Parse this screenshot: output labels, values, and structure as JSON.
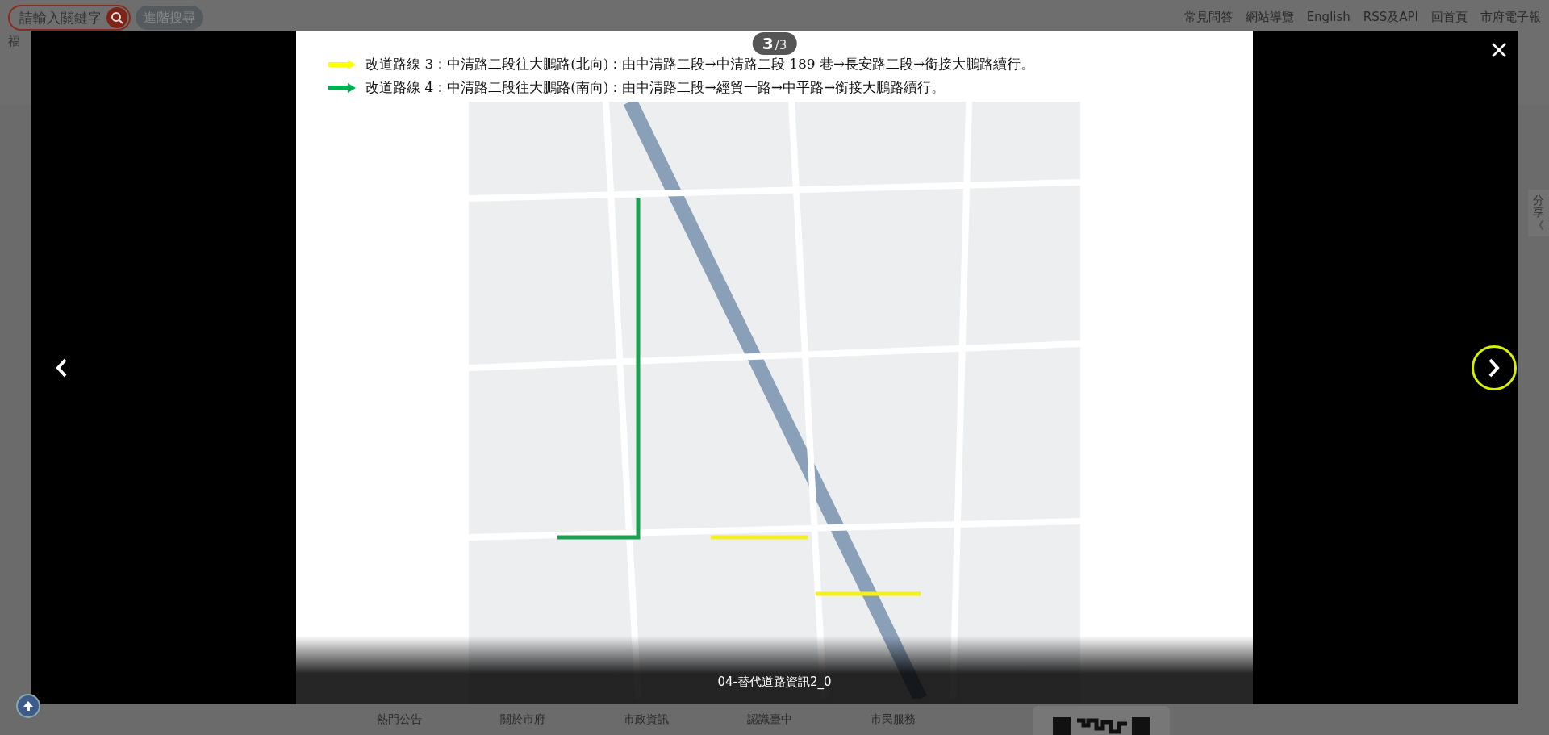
{
  "header": {
    "search": {
      "placeholder": "請輸入關鍵字"
    },
    "advanced_search": "進階搜尋",
    "left_text": "福",
    "links": [
      "常見問答",
      "網站導覽",
      "English",
      "RSS及API",
      "回首頁",
      "市府電子報"
    ]
  },
  "share_tab": {
    "label": "分享",
    "chevron": "《"
  },
  "lightbox": {
    "counter": {
      "current": "3",
      "total": "/3"
    },
    "legend": [
      {
        "label": "改道路線 3：中清路二段往大鵬路(北向)：由中清路二段→中清路二段 189 巷→長安路二段→銜接大鵬路續行。",
        "color": "#ffff00"
      },
      {
        "label": "改道路線 4：中清路二段往大鵬路(南向)：由中清路二段→經貿一路→中平路→銜接大鵬路續行。",
        "color": "#00b050"
      }
    ],
    "caption": "04-替代道路資訊2_0"
  },
  "footer": {
    "nav": [
      "熱門公告",
      "關於市府",
      "市政資訊",
      "認識臺中",
      "市民服務"
    ]
  }
}
